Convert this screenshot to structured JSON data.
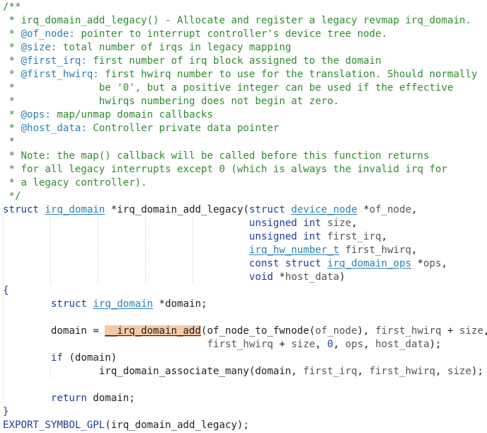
{
  "editor": {
    "language": "c",
    "lines": [
      [
        {
          "t": "/**",
          "c": "comment"
        }
      ],
      [
        {
          "t": " * irq_domain_add_legacy() - Allocate and register a legacy revmap irq_domain.",
          "c": "comment"
        }
      ],
      [
        {
          "t": " * ",
          "c": "comment"
        },
        {
          "t": "@of_node:",
          "c": "tag"
        },
        {
          "t": " pointer to interrupt controller's device tree node.",
          "c": "comment"
        }
      ],
      [
        {
          "t": " * ",
          "c": "comment"
        },
        {
          "t": "@size:",
          "c": "tag"
        },
        {
          "t": " total number of irqs in legacy mapping",
          "c": "comment"
        }
      ],
      [
        {
          "t": " * ",
          "c": "comment"
        },
        {
          "t": "@first_irq:",
          "c": "tag"
        },
        {
          "t": " first number of irq block assigned to the domain",
          "c": "comment"
        }
      ],
      [
        {
          "t": " * ",
          "c": "comment"
        },
        {
          "t": "@first_hwirq:",
          "c": "tag"
        },
        {
          "t": " first hwirq number to use for the translation. Should normally",
          "c": "comment"
        }
      ],
      [
        {
          "t": " *              be '0', but a positive integer can be used if the effective",
          "c": "comment"
        }
      ],
      [
        {
          "t": " *              hwirqs numbering does not begin at zero.",
          "c": "comment"
        }
      ],
      [
        {
          "t": " * ",
          "c": "comment"
        },
        {
          "t": "@ops:",
          "c": "tag"
        },
        {
          "t": " map/unmap domain callbacks",
          "c": "comment"
        }
      ],
      [
        {
          "t": " * ",
          "c": "comment"
        },
        {
          "t": "@host_data:",
          "c": "tag"
        },
        {
          "t": " Controller private data pointer",
          "c": "comment"
        }
      ],
      [
        {
          "t": " *",
          "c": "comment"
        }
      ],
      [
        {
          "t": " * Note: the map() callback will be called before this function returns",
          "c": "comment"
        }
      ],
      [
        {
          "t": " * for all legacy interrupts except 0 (which is always the invalid irq for",
          "c": "comment"
        }
      ],
      [
        {
          "t": " * a legacy controller).",
          "c": "comment"
        }
      ],
      [
        {
          "t": " */",
          "c": "comment"
        }
      ],
      [
        {
          "t": "struct",
          "c": "keyword"
        },
        {
          "t": " ",
          "c": "plain"
        },
        {
          "t": "irq_domain",
          "c": "type-under"
        },
        {
          "t": " *irq_domain_add_legacy(",
          "c": "func"
        },
        {
          "t": "struct",
          "c": "keyword"
        },
        {
          "t": " ",
          "c": "plain"
        },
        {
          "t": "device_node",
          "c": "type-under"
        },
        {
          "t": " *",
          "c": "plain"
        },
        {
          "t": "of_node",
          "c": "param"
        },
        {
          "t": ",",
          "c": "plain"
        }
      ],
      [
        {
          "t": "                                         ",
          "c": "plain"
        },
        {
          "t": "unsigned int",
          "c": "keyword"
        },
        {
          "t": " ",
          "c": "plain"
        },
        {
          "t": "size",
          "c": "param"
        },
        {
          "t": ",",
          "c": "plain"
        }
      ],
      [
        {
          "t": "                                         ",
          "c": "plain"
        },
        {
          "t": "unsigned int",
          "c": "keyword"
        },
        {
          "t": " ",
          "c": "plain"
        },
        {
          "t": "first_irq",
          "c": "param"
        },
        {
          "t": ",",
          "c": "plain"
        }
      ],
      [
        {
          "t": "                                         ",
          "c": "plain"
        },
        {
          "t": "irq_hw_number_t",
          "c": "type-under"
        },
        {
          "t": " ",
          "c": "plain"
        },
        {
          "t": "first_hwirq",
          "c": "param"
        },
        {
          "t": ",",
          "c": "plain"
        }
      ],
      [
        {
          "t": "                                         ",
          "c": "plain"
        },
        {
          "t": "const",
          "c": "keyword"
        },
        {
          "t": " ",
          "c": "plain"
        },
        {
          "t": "struct",
          "c": "keyword"
        },
        {
          "t": " ",
          "c": "plain"
        },
        {
          "t": "irq_domain_ops",
          "c": "type-under"
        },
        {
          "t": " *",
          "c": "plain"
        },
        {
          "t": "ops",
          "c": "param"
        },
        {
          "t": ",",
          "c": "plain"
        }
      ],
      [
        {
          "t": "                                         ",
          "c": "plain"
        },
        {
          "t": "void",
          "c": "keyword"
        },
        {
          "t": " *",
          "c": "plain"
        },
        {
          "t": "host_data",
          "c": "param"
        },
        {
          "t": ")",
          "c": "plain"
        }
      ],
      [
        {
          "t": "{",
          "c": "keyword"
        }
      ],
      [
        {
          "t": "        ",
          "c": "plain"
        },
        {
          "t": "struct",
          "c": "keyword"
        },
        {
          "t": " ",
          "c": "plain"
        },
        {
          "t": "irq_domain",
          "c": "type-under"
        },
        {
          "t": " *domain;",
          "c": "plain"
        }
      ],
      [
        {
          "t": "",
          "c": "plain"
        }
      ],
      [
        {
          "t": "        domain = ",
          "c": "plain"
        },
        {
          "t": "__irq_domain_add",
          "c": "highlight"
        },
        {
          "t": "(of_node_to_fwnode(",
          "c": "plain"
        },
        {
          "t": "of_node",
          "c": "param"
        },
        {
          "t": "), ",
          "c": "plain"
        },
        {
          "t": "first_hwirq",
          "c": "param"
        },
        {
          "t": " + ",
          "c": "plain"
        },
        {
          "t": "size",
          "c": "param"
        },
        {
          "t": ",",
          "c": "plain"
        }
      ],
      [
        {
          "t": "                                  ",
          "c": "plain"
        },
        {
          "t": "first_hwirq",
          "c": "param"
        },
        {
          "t": " + ",
          "c": "plain"
        },
        {
          "t": "size",
          "c": "param"
        },
        {
          "t": ", ",
          "c": "plain"
        },
        {
          "t": "0",
          "c": "num"
        },
        {
          "t": ", ",
          "c": "plain"
        },
        {
          "t": "ops",
          "c": "param"
        },
        {
          "t": ", ",
          "c": "plain"
        },
        {
          "t": "host_data",
          "c": "param"
        },
        {
          "t": ");",
          "c": "plain"
        }
      ],
      [
        {
          "t": "        ",
          "c": "plain"
        },
        {
          "t": "if",
          "c": "keyword"
        },
        {
          "t": " (domain)",
          "c": "plain"
        }
      ],
      [
        {
          "t": "                irq_domain_associate_many(domain, ",
          "c": "plain"
        },
        {
          "t": "first_irq",
          "c": "param"
        },
        {
          "t": ", ",
          "c": "plain"
        },
        {
          "t": "first_hwirq",
          "c": "param"
        },
        {
          "t": ", ",
          "c": "plain"
        },
        {
          "t": "size",
          "c": "param"
        },
        {
          "t": ");",
          "c": "plain"
        }
      ],
      [
        {
          "t": "",
          "c": "plain"
        }
      ],
      [
        {
          "t": "        ",
          "c": "plain"
        },
        {
          "t": "return",
          "c": "keyword"
        },
        {
          "t": " domain;",
          "c": "plain"
        }
      ],
      [
        {
          "t": "}",
          "c": "keyword"
        }
      ],
      [
        {
          "t": "EXPORT_SYMBOL_GPL",
          "c": "macro"
        },
        {
          "t": "(irq_domain_add_legacy);",
          "c": "plain"
        }
      ]
    ]
  },
  "colors": {
    "background": "#ffffff",
    "comment": "#2f8c2f",
    "doc_tag": "#2b7fb8",
    "keyword": "#1c3d9c",
    "type": "#2b7fb8",
    "parameter": "#555555",
    "highlight": "#f5c9a6"
  }
}
